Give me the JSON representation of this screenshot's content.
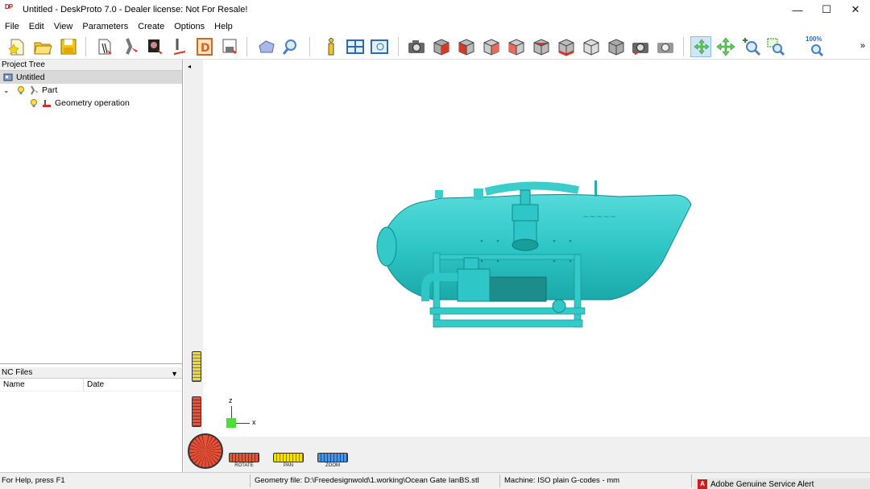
{
  "window": {
    "logo_text": "DP",
    "title": "Untitled - DeskProto 7.0 - Dealer license: Not For Resale!",
    "minimize": "—",
    "maximize": "☐",
    "close": "✕"
  },
  "menu": [
    "File",
    "Edit",
    "View",
    "Parameters",
    "Create",
    "Options",
    "Help"
  ],
  "toolbar": {
    "zoom_label": "100%",
    "more": "»"
  },
  "project_tree": {
    "header": "Project Tree",
    "root": "Untitled",
    "part": "Part",
    "operation": "Geometry operation"
  },
  "nc_files": {
    "header": "NC Files",
    "dropdown": "▼",
    "columns": [
      "Name",
      "Date"
    ]
  },
  "viewport": {
    "collapse_arrow": "◂",
    "axis_z": "z",
    "axis_x": "x",
    "rotate_label": "ROTATE",
    "pan_label": "PAN",
    "zoom_label": "ZOOM",
    "model_color": "#2ec6c6"
  },
  "status": {
    "help": "For Help, press F1",
    "geometry_file": "Geometry file: D:\\Freedesignwold\\1.working\\Ocean Gate IanBS.stl",
    "machine": "Machine: ISO plain G-codes - mm",
    "adobe_icon": "A",
    "adobe_alert": "Adobe Genuine Service Alert"
  }
}
